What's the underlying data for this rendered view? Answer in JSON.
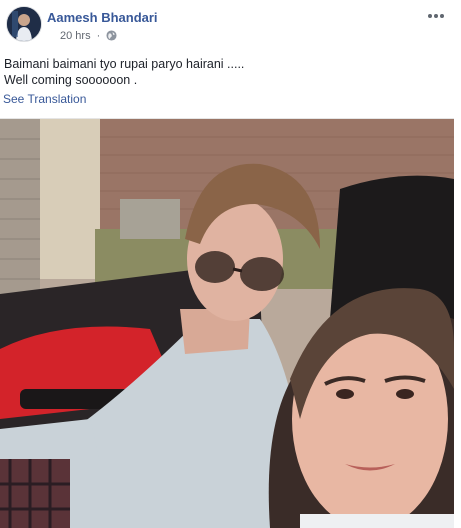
{
  "post": {
    "author": "Aamesh Bhandari",
    "time": "20 hrs",
    "separator": "·",
    "privacy_icon": "globe-icon",
    "more_icon": "more-options-icon",
    "text_lines": [
      "Baimani baimani tyo rupai paryo hairani .....",
      "Well coming soooooon ."
    ],
    "see_translation": "See Translation"
  },
  "colors": {
    "author_link": "#385898",
    "meta_text": "#616770",
    "body_text": "#1d2129"
  }
}
